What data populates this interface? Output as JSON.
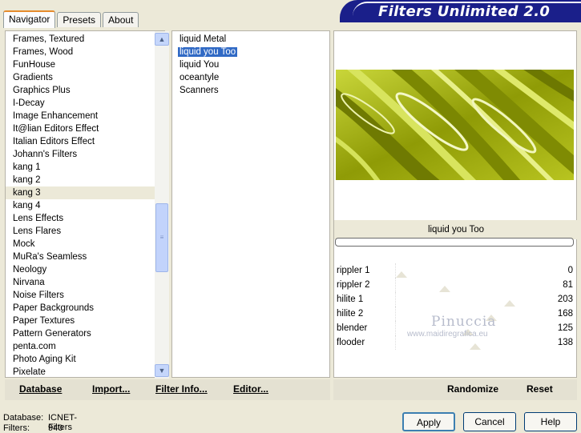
{
  "tabs": [
    "Navigator",
    "Presets",
    "About"
  ],
  "banner_title": "Filters Unlimited 2.0",
  "categories": [
    "Frames, Textured",
    "Frames, Wood",
    "FunHouse",
    "Gradients",
    "Graphics Plus",
    "I-Decay",
    "Image Enhancement",
    "It@lian Editors Effect",
    "Italian Editors Effect",
    "Johann's Filters",
    "kang 1",
    "kang 2",
    "kang 3",
    "kang 4",
    "Lens Effects",
    "Lens Flares",
    "Mock",
    "MuRa's Seamless",
    "Neology",
    "Nirvana",
    "Noise Filters",
    "Paper Backgrounds",
    "Paper Textures",
    "Pattern Generators",
    "penta.com",
    "Photo Aging Kit",
    "Pixelate"
  ],
  "selected_category": "kang 3",
  "filters": [
    "liquid Metal",
    "liquid you Too",
    "liquid You",
    "oceantyle",
    "Scanners"
  ],
  "selected_filter": "liquid you Too",
  "filter_name": "liquid you Too",
  "sliders": [
    {
      "label": "rippler 1",
      "value": "0",
      "pos": 0.0
    },
    {
      "label": "rippler 2",
      "value": "81",
      "pos": 0.318
    },
    {
      "label": "hilite 1",
      "value": "203",
      "pos": 0.796
    },
    {
      "label": "hilite 2",
      "value": "168",
      "pos": 0.659
    },
    {
      "label": "blender",
      "value": "125",
      "pos": 0.49
    },
    {
      "label": "flooder",
      "value": "138",
      "pos": 0.541
    }
  ],
  "buttons": {
    "database": "Database",
    "import": "Import...",
    "filter_info": "Filter Info...",
    "editor": "Editor...",
    "randomize": "Randomize",
    "reset": "Reset",
    "apply": "Apply",
    "cancel": "Cancel",
    "help": "Help"
  },
  "status": {
    "database_label": "Database:",
    "database_value": "ICNET-Filters",
    "filters_label": "Filters:",
    "filters_value": "940"
  },
  "watermark": {
    "line1": "Pinuccia",
    "line2": "www.maidiregrafica.eu"
  },
  "colors": {
    "selection": "#316ac5",
    "banner": "#1a1f8a",
    "preview_base": "#9aa80a"
  }
}
